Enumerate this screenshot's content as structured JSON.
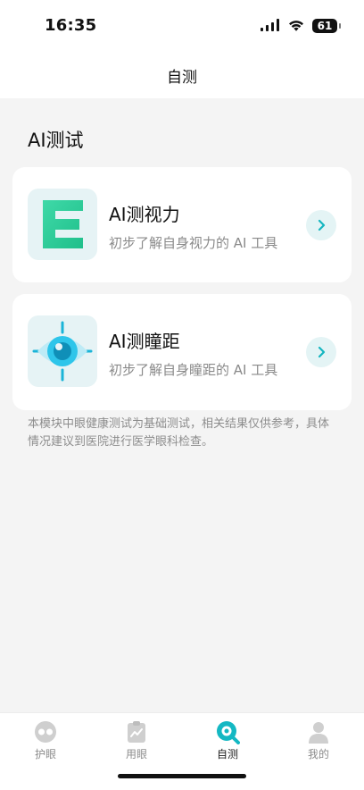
{
  "status_bar": {
    "time": "16:35",
    "battery": "61"
  },
  "header": {
    "title": "自测"
  },
  "main": {
    "section_title": "AI测试",
    "cards": [
      {
        "title": "AI测视力",
        "subtitle": "初步了解自身视力的 AI 工具",
        "icon": "vision-e-icon"
      },
      {
        "title": "AI测瞳距",
        "subtitle": "初步了解自身瞳距的 AI 工具",
        "icon": "eye-scan-icon"
      }
    ],
    "disclaimer": "本模块中眼健康测试为基础测试，相关结果仅供参考，具体情况建议到医院进行医学眼科检查。"
  },
  "tabs": [
    {
      "label": "护眼",
      "active": false
    },
    {
      "label": "用眼",
      "active": false
    },
    {
      "label": "自测",
      "active": true
    },
    {
      "label": "我的",
      "active": false
    }
  ],
  "colors": {
    "accent": "#14b8c3",
    "card_bg": "#ffffff",
    "page_bg": "#f4f4f4",
    "muted_text": "#8a8a8a"
  }
}
